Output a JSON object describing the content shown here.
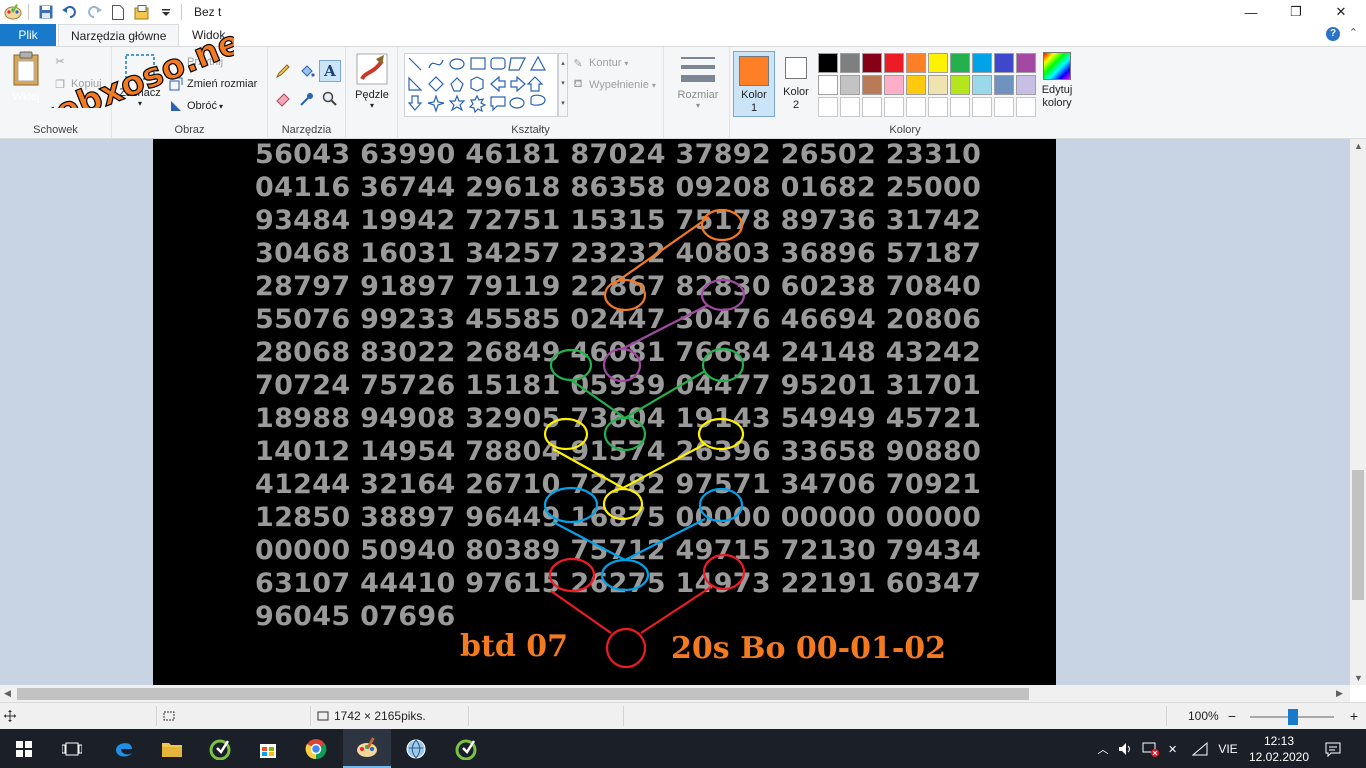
{
  "window": {
    "title": "Bez tytułu - Paint",
    "title_visible": "Bez t",
    "minimize_glyph": "—",
    "maximize_glyph": "❐",
    "close_glyph": "✕"
  },
  "tabs": {
    "file": "Plik",
    "home": "Narzędzia główne",
    "view": "Widok"
  },
  "ribbon": {
    "clipboard": {
      "paste": "Wklej",
      "cut": "Wytnij",
      "copy": "Kopiuj",
      "label": "Schowek"
    },
    "image": {
      "select": "Zaznacz",
      "crop": "Przytnij",
      "resize": "Zmień rozmiar",
      "rotate": "Obróć",
      "label": "Obraz"
    },
    "tools": {
      "label": "Narzędzia"
    },
    "brushes": {
      "label": "Pędzle"
    },
    "shapes": {
      "outline": "Kontur",
      "fill": "Wypełnienie",
      "label": "Kształty"
    },
    "size": {
      "label": "Rozmiar"
    },
    "colors": {
      "color1": "Kolor 1",
      "color2": "Kolor 2",
      "edit": "Edytuj kolory",
      "label": "Kolory",
      "color1_value": "#ff7f27",
      "color2_value": "#ffffff",
      "palette_row1": [
        "#000000",
        "#7f7f7f",
        "#880015",
        "#ed1c24",
        "#ff7f27",
        "#fff200",
        "#22b14c",
        "#00a2e8",
        "#3f48cc",
        "#a349a4"
      ],
      "palette_row2": [
        "#ffffff",
        "#c3c3c3",
        "#b97a57",
        "#ffaec9",
        "#ffc90e",
        "#efe4b0",
        "#b5e61d",
        "#99d9ea",
        "#7092be",
        "#c8bfe7"
      ]
    }
  },
  "canvas": {
    "rows": [
      "56043 63990 46181 87024 37892 26502 23310",
      "04116 36744 29618 86358 09208 01682 25000",
      "93484 19942 72751 15315 75178 89736 31742",
      "30468 16031 34257 23232 40803 36896 57187",
      "28797 91897 79119 22867 82830 60238 70840",
      "55076 99233 45585 02447 30476 46694 20806",
      "28068 83022 26849 46081 76684 24148 43242",
      "70724 75726 15181 05939 04477 95201 31701",
      "18988 94908 32905 73604 19143 54949 45721",
      "14012 14954 78804 91574 26396 33658 90880",
      "41244 32164 26710 72782 97571 34706 70921",
      "12850 38897 96449 16875 00000 00000 00000",
      "00000 50940 80389 75712 49715 72130 79434",
      "63107 44410 97615 26275 14973 22191 60347",
      "96045 07696"
    ],
    "btd_label": "btd 07",
    "bo_label": "20s Bo 00-01-02"
  },
  "watermark": {
    "text": "webxoso.net"
  },
  "status": {
    "dimensions": "1742 × 2165piks.",
    "zoom": "100%",
    "zoom_minus": "−",
    "zoom_plus": "+"
  },
  "taskbar": {
    "language": "VIE",
    "time": "12:13",
    "date": "12.02.2020"
  }
}
